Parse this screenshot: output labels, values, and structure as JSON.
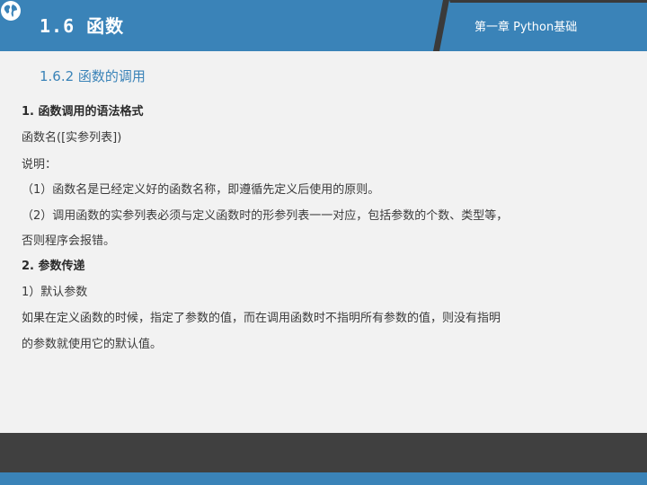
{
  "header": {
    "title": "1.6  函数",
    "chapter": "第一章 Python基础",
    "icon": "globe-icon",
    "colors": {
      "bar": "#3a83b8",
      "accent_dark": "#404040"
    }
  },
  "content": {
    "section_heading": "1.6.2  函数的调用",
    "lines": [
      "1. 函数调用的语法格式",
      "函数名([实参列表])",
      "说明：",
      "（1）函数名是已经定义好的函数名称，即遵循先定义后使用的原则。",
      "（2）调用函数的实参列表必须与定义函数时的形参列表一一对应，包括参数的个数、类型等，",
      "否则程序会报错。",
      "2. 参数传递",
      "1）默认参数",
      "如果在定义函数的时候，指定了参数的值，而在调用函数时不指明所有参数的值，则没有指明",
      "的参数就使用它的默认值。"
    ]
  }
}
